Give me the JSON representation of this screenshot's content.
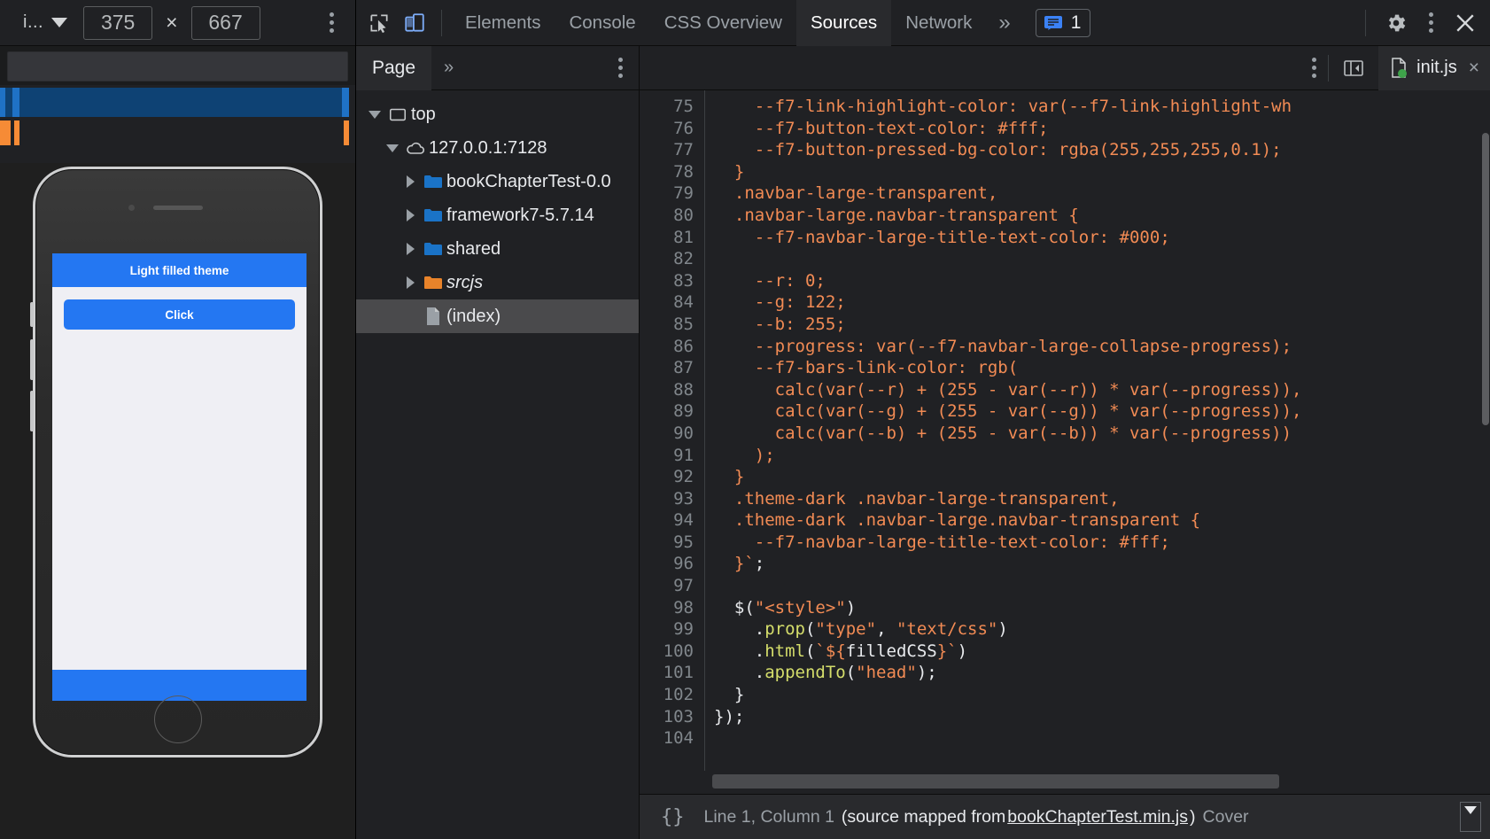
{
  "device_toolbar": {
    "device_name": "i...",
    "width": "375",
    "height": "667",
    "times_symbol": "×",
    "more_options_label": "⋮"
  },
  "phone_preview": {
    "navbar_title": "Light filled theme",
    "button_label": "Click",
    "accent_color": "#2477f2",
    "page_bg": "#efeff4"
  },
  "devtools": {
    "tabs": [
      {
        "label": "Elements",
        "active": false
      },
      {
        "label": "Console",
        "active": false
      },
      {
        "label": "CSS Overview",
        "active": false
      },
      {
        "label": "Sources",
        "active": true
      },
      {
        "label": "Network",
        "active": false
      }
    ],
    "more_tabs_label": "»",
    "issues_count": "1",
    "icons": {
      "inspect": "inspect-element-icon",
      "device": "toggle-device-toolbar-icon",
      "issues": "issues-message-icon",
      "settings": "gear-icon",
      "main_menu": "kebab-menu-icon",
      "close": "close-icon"
    }
  },
  "navigator": {
    "tab_label": "Page",
    "more_label": "»",
    "tree": [
      {
        "label": "top",
        "icon": "frame-icon",
        "depth": 0,
        "expanded": true,
        "selected": false,
        "italic": false
      },
      {
        "label": "127.0.0.1:7128",
        "icon": "cloud-icon",
        "depth": 1,
        "expanded": true,
        "selected": false,
        "italic": false
      },
      {
        "label": "bookChapterTest-0.0",
        "icon": "folder-blue-icon",
        "depth": 2,
        "expanded": false,
        "selected": false,
        "italic": false
      },
      {
        "label": "framework7-5.7.14",
        "icon": "folder-blue-icon",
        "depth": 2,
        "expanded": false,
        "selected": false,
        "italic": false
      },
      {
        "label": "shared",
        "icon": "folder-blue-icon",
        "depth": 2,
        "expanded": false,
        "selected": false,
        "italic": false
      },
      {
        "label": "srcjs",
        "icon": "folder-orange-icon",
        "depth": 2,
        "expanded": false,
        "selected": false,
        "italic": true
      },
      {
        "label": "(index)",
        "icon": "document-icon",
        "depth": 2,
        "expanded": null,
        "selected": true,
        "italic": false
      }
    ]
  },
  "editor": {
    "open_file": "init.js",
    "close_label": "×",
    "first_line_number": 75,
    "lines": [
      {
        "n": 75,
        "tokens": [
          {
            "t": "    --f7-link-highlight-color: var(--f7-link-highlight-wh",
            "c": "s-str"
          }
        ]
      },
      {
        "n": 76,
        "tokens": [
          {
            "t": "    --f7-button-text-color: #fff;",
            "c": "s-str"
          }
        ]
      },
      {
        "n": 77,
        "tokens": [
          {
            "t": "    --f7-button-pressed-bg-color: rgba(255,255,255,0.1);",
            "c": "s-str"
          }
        ]
      },
      {
        "n": 78,
        "tokens": [
          {
            "t": "  }",
            "c": "s-str"
          }
        ]
      },
      {
        "n": 79,
        "tokens": [
          {
            "t": "  .navbar-large-transparent,",
            "c": "s-str"
          }
        ]
      },
      {
        "n": 80,
        "tokens": [
          {
            "t": "  .navbar-large.navbar-transparent {",
            "c": "s-str"
          }
        ]
      },
      {
        "n": 81,
        "tokens": [
          {
            "t": "    --f7-navbar-large-title-text-color: #000;",
            "c": "s-str"
          }
        ]
      },
      {
        "n": 82,
        "tokens": [
          {
            "t": "",
            "c": "s-str"
          }
        ]
      },
      {
        "n": 83,
        "tokens": [
          {
            "t": "    --r: 0;",
            "c": "s-str"
          }
        ]
      },
      {
        "n": 84,
        "tokens": [
          {
            "t": "    --g: 122;",
            "c": "s-str"
          }
        ]
      },
      {
        "n": 85,
        "tokens": [
          {
            "t": "    --b: 255;",
            "c": "s-str"
          }
        ]
      },
      {
        "n": 86,
        "tokens": [
          {
            "t": "    --progress: var(--f7-navbar-large-collapse-progress);",
            "c": "s-str"
          }
        ]
      },
      {
        "n": 87,
        "tokens": [
          {
            "t": "    --f7-bars-link-color: rgb(",
            "c": "s-str"
          }
        ]
      },
      {
        "n": 88,
        "tokens": [
          {
            "t": "      calc(var(--r) + (255 - var(--r)) * var(--progress)),",
            "c": "s-str"
          }
        ]
      },
      {
        "n": 89,
        "tokens": [
          {
            "t": "      calc(var(--g) + (255 - var(--g)) * var(--progress)),",
            "c": "s-str"
          }
        ]
      },
      {
        "n": 90,
        "tokens": [
          {
            "t": "      calc(var(--b) + (255 - var(--b)) * var(--progress))",
            "c": "s-str"
          }
        ]
      },
      {
        "n": 91,
        "tokens": [
          {
            "t": "    );",
            "c": "s-str"
          }
        ]
      },
      {
        "n": 92,
        "tokens": [
          {
            "t": "  }",
            "c": "s-str"
          }
        ]
      },
      {
        "n": 93,
        "tokens": [
          {
            "t": "  .theme-dark .navbar-large-transparent,",
            "c": "s-str"
          }
        ]
      },
      {
        "n": 94,
        "tokens": [
          {
            "t": "  .theme-dark .navbar-large.navbar-transparent {",
            "c": "s-str"
          }
        ]
      },
      {
        "n": 95,
        "tokens": [
          {
            "t": "    --f7-navbar-large-title-text-color: #fff;",
            "c": "s-str"
          }
        ]
      },
      {
        "n": 96,
        "tokens": [
          {
            "t": "  }",
            "c": "s-str"
          },
          {
            "t": "`",
            "c": "s-str"
          },
          {
            "t": ";",
            "c": "s-plain"
          }
        ]
      },
      {
        "n": 97,
        "tokens": [
          {
            "t": "",
            "c": "s-plain"
          }
        ]
      },
      {
        "n": 98,
        "tokens": [
          {
            "t": "  $(",
            "c": "s-plain"
          },
          {
            "t": "\"<style>\"",
            "c": "s-str"
          },
          {
            "t": ")",
            "c": "s-plain"
          }
        ]
      },
      {
        "n": 99,
        "tokens": [
          {
            "t": "    .",
            "c": "s-plain"
          },
          {
            "t": "prop",
            "c": "s-fn"
          },
          {
            "t": "(",
            "c": "s-plain"
          },
          {
            "t": "\"type\"",
            "c": "s-str"
          },
          {
            "t": ", ",
            "c": "s-plain"
          },
          {
            "t": "\"text/css\"",
            "c": "s-str"
          },
          {
            "t": ")",
            "c": "s-plain"
          }
        ]
      },
      {
        "n": 100,
        "tokens": [
          {
            "t": "    .",
            "c": "s-plain"
          },
          {
            "t": "html",
            "c": "s-fn"
          },
          {
            "t": "(",
            "c": "s-plain"
          },
          {
            "t": "`",
            "c": "s-str"
          },
          {
            "t": "${",
            "c": "s-str"
          },
          {
            "t": "filledCSS",
            "c": "s-plain"
          },
          {
            "t": "}",
            "c": "s-str"
          },
          {
            "t": "`",
            "c": "s-str"
          },
          {
            "t": ")",
            "c": "s-plain"
          }
        ]
      },
      {
        "n": 101,
        "tokens": [
          {
            "t": "    .",
            "c": "s-plain"
          },
          {
            "t": "appendTo",
            "c": "s-fn"
          },
          {
            "t": "(",
            "c": "s-plain"
          },
          {
            "t": "\"head\"",
            "c": "s-str"
          },
          {
            "t": ");",
            "c": "s-plain"
          }
        ]
      },
      {
        "n": 102,
        "tokens": [
          {
            "t": "  }",
            "c": "s-plain"
          }
        ]
      },
      {
        "n": 103,
        "tokens": [
          {
            "t": "});",
            "c": "s-plain"
          }
        ]
      },
      {
        "n": 104,
        "tokens": [
          {
            "t": "",
            "c": "s-plain"
          }
        ]
      }
    ]
  },
  "statusbar": {
    "format_icon_label": "{}",
    "cursor_position": "Line 1, Column 1",
    "source_map_prefix": "(source mapped from ",
    "source_map_link": "bookChapterTest.min.js",
    "source_map_suffix": ")",
    "coverage_label": "Cover"
  }
}
